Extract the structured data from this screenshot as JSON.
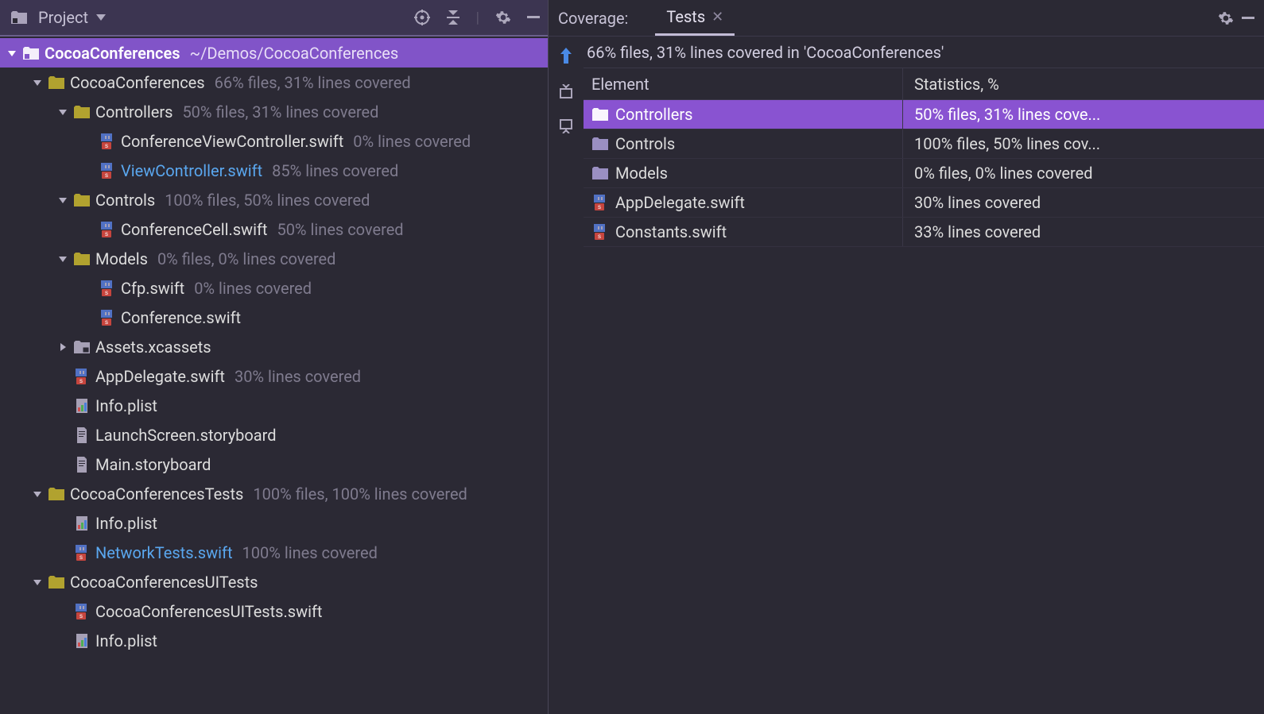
{
  "left_panel": {
    "title": "Project",
    "root": {
      "name": "CocoaConferences",
      "path": "~/Demos/CocoaConferences"
    },
    "tree": [
      {
        "indent": 1,
        "arrow": "down",
        "icon": "folder",
        "name": "CocoaConferences",
        "sub": "66% files, 31% lines covered"
      },
      {
        "indent": 2,
        "arrow": "down",
        "icon": "folder",
        "name": "Controllers",
        "sub": "50% files, 31% lines covered"
      },
      {
        "indent": 3,
        "arrow": "",
        "icon": "swift",
        "name": "ConferenceViewController.swift",
        "sub": "0% lines covered"
      },
      {
        "indent": 3,
        "arrow": "",
        "icon": "swift",
        "name": "ViewController.swift",
        "name_style": "blue",
        "sub": "85% lines covered"
      },
      {
        "indent": 2,
        "arrow": "down",
        "icon": "folder",
        "name": "Controls",
        "sub": "100% files, 50% lines covered"
      },
      {
        "indent": 3,
        "arrow": "",
        "icon": "swift",
        "name": "ConferenceCell.swift",
        "sub": "50% lines covered"
      },
      {
        "indent": 2,
        "arrow": "down",
        "icon": "folder",
        "name": "Models",
        "sub": "0% files, 0% lines covered"
      },
      {
        "indent": 3,
        "arrow": "",
        "icon": "swift",
        "name": "Cfp.swift",
        "sub": "0% lines covered"
      },
      {
        "indent": 3,
        "arrow": "",
        "icon": "swift",
        "name": "Conference.swift",
        "sub": ""
      },
      {
        "indent": 2,
        "arrow": "right",
        "icon": "assets",
        "name": "Assets.xcassets",
        "sub": ""
      },
      {
        "indent": 2,
        "arrow": "",
        "icon": "swift",
        "name": "AppDelegate.swift",
        "sub": "30% lines covered"
      },
      {
        "indent": 2,
        "arrow": "",
        "icon": "plist",
        "name": "Info.plist",
        "sub": ""
      },
      {
        "indent": 2,
        "arrow": "",
        "icon": "file",
        "name": "LaunchScreen.storyboard",
        "sub": ""
      },
      {
        "indent": 2,
        "arrow": "",
        "icon": "file",
        "name": "Main.storyboard",
        "sub": ""
      },
      {
        "indent": 1,
        "arrow": "down",
        "icon": "folder",
        "name": "CocoaConferencesTests",
        "sub": "100% files, 100% lines covered"
      },
      {
        "indent": 2,
        "arrow": "",
        "icon": "plist",
        "name": "Info.plist",
        "sub": ""
      },
      {
        "indent": 2,
        "arrow": "",
        "icon": "swift",
        "name": "NetworkTests.swift",
        "name_style": "blue",
        "sub": "100% lines covered"
      },
      {
        "indent": 1,
        "arrow": "down",
        "icon": "folder",
        "name": "CocoaConferencesUITests",
        "sub": ""
      },
      {
        "indent": 2,
        "arrow": "",
        "icon": "swift",
        "name": "CocoaConferencesUITests.swift",
        "sub": ""
      },
      {
        "indent": 2,
        "arrow": "",
        "icon": "plist",
        "name": "Info.plist",
        "sub": ""
      }
    ]
  },
  "right_panel": {
    "coverage_label": "Coverage:",
    "tabs": [
      {
        "label": "Tests",
        "active": true
      }
    ],
    "summary": "66% files, 31% lines covered in 'CocoaConferences'",
    "columns": {
      "element": "Element",
      "stats": "Statistics, %"
    },
    "rows": [
      {
        "icon": "folder-purple",
        "name": "Controllers",
        "stats": "50% files, 31% lines cove...",
        "selected": true
      },
      {
        "icon": "folder-purple",
        "name": "Controls",
        "stats": "100% files, 50% lines cov...",
        "selected": false
      },
      {
        "icon": "folder-purple",
        "name": "Models",
        "stats": "0% files, 0% lines covered",
        "selected": false
      },
      {
        "icon": "swift",
        "name": "AppDelegate.swift",
        "stats": "30% lines covered",
        "selected": false
      },
      {
        "icon": "swift",
        "name": "Constants.swift",
        "stats": "33% lines covered",
        "selected": false
      }
    ]
  }
}
